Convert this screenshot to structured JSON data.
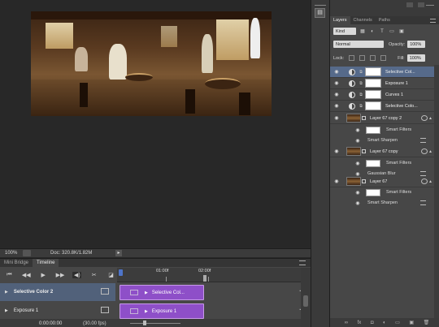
{
  "canvas": {
    "image_alt": "Vintage cafe interior scene"
  },
  "status_bar": {
    "zoom": "100%",
    "doc": "Doc: 320.8K/1.82M",
    "arrow": "▸"
  },
  "bottom_panel": {
    "tabs": [
      "Mini Bridge",
      "Timeline"
    ],
    "ruler": {
      "t1": "01:00f",
      "t2": "02:00f"
    },
    "tracks": [
      {
        "label": "Selective Color 2",
        "clip": "Selective Col..."
      },
      {
        "label": "Exposure 1",
        "clip": "Exposure 1"
      }
    ],
    "timecode": "0:00:00:00",
    "fps": "(30.00 fps)"
  },
  "layers_panel": {
    "tabs": [
      "Layers",
      "Channels",
      "Paths"
    ],
    "filter": "Kind",
    "blend": "Normal",
    "opacity_label": "Opacity:",
    "opacity_value": "100%",
    "lock_label": "Lock:",
    "fill_label": "Fill:",
    "fill_value": "100%",
    "layers": [
      {
        "name": "Selective Col...",
        "kind": "adjustment"
      },
      {
        "name": "Exposure 1",
        "kind": "adjustment"
      },
      {
        "name": "Curves 1",
        "kind": "adjustment"
      },
      {
        "name": "Selective Colo...",
        "kind": "adjustment"
      },
      {
        "name": "Layer 67 copy 2",
        "kind": "smart",
        "filters": [
          "Smart Filters",
          "Smart Sharpen"
        ]
      },
      {
        "name": "Layer 67 copy",
        "kind": "smart",
        "filters": [
          "Smart Filters",
          "Gaussian Blur"
        ]
      },
      {
        "name": "Layer 67",
        "kind": "smart",
        "filters": [
          "Smart Filters",
          "Smart Sharpen"
        ]
      }
    ],
    "footer": [
      "∞",
      "fx",
      "◘",
      "◐",
      "▭",
      "▣",
      "🗑"
    ]
  }
}
